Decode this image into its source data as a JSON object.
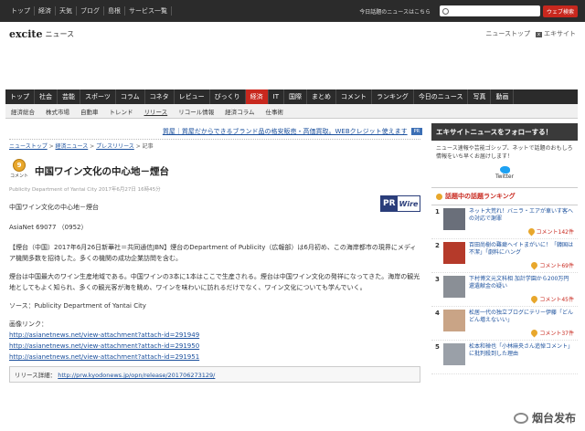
{
  "topbar": {
    "links": [
      "トップ",
      "経済",
      "天気",
      "ブログ",
      "島根",
      "サービス一覧"
    ],
    "today_news": "今日話題のニュースはこちら",
    "search_button": "ウェブ検索"
  },
  "header": {
    "logo": "excite",
    "logo_sub": "ニュース",
    "news_top": "ニューストップ",
    "excite_site": "エキサイト"
  },
  "nav_primary": [
    "トップ",
    "社会",
    "芸能",
    "スポーツ",
    "コラム",
    "コネタ",
    "レビュー",
    "びっくり",
    "経済",
    "IT",
    "国際",
    "まとめ",
    "コメント",
    "ランキング",
    "今日のニュース",
    "写真",
    "動画"
  ],
  "nav_secondary": [
    "経済総合",
    "株式市場",
    "自動車",
    "トレンド",
    "リリース",
    "リコール情報",
    "経済コラム",
    "仕事術"
  ],
  "banner": {
    "text": "質屋｜質屋だからできるブランド品の格安販売・高価買取。WEBクレジット使えます",
    "tag": "PR"
  },
  "breadcrumb": {
    "items": [
      "ニューストップ",
      "経済ニュース",
      "プレスリリース"
    ],
    "current": "記事"
  },
  "article": {
    "comment_label": "コメント",
    "title": "中国ワイン文化の中心地－煙台",
    "byline": "Publicity Department of Yantai City 2017年6月27日 16時45分",
    "subtitle": "中国ワイン文化の中心地－煙台",
    "release_id": "AsiaNet 69077 （0952）",
    "para1": "【煙台（中国）2017年6月26日新華社＝共同通信JBN】煙台のDepartment of Publicity（広報部）は6月初め、この海岸都市の現界にメディア機関多数を招待した。多くの機関の成功企業訪問を含む。",
    "para2": "煙台は中国最大のワイン生産地域である。中国ワインの3本に1本はここで生産される。煙台は中国ワイン文化の発祥になってきた。海岸の観光地としてもよく知られ、多くの観光客が海を眺め、ワインを味わいに訪れるだけでなく、ワイン文化についても学んでいく。",
    "source": "ソース：Publicity Department of Yantai City",
    "image_links_label": "画像リンク：",
    "image_links": [
      "http://asianetnews.net/view-attachment?attach-id=291949",
      "http://asianetnews.net/view-attachment?attach-id=291950",
      "http://asianetnews.net/view-attachment?attach-id=291951"
    ],
    "release_detail_label": "リリース詳細：",
    "release_detail_url": "http://prw.kyodonews.jp/opn/release/201706273129/",
    "pr_logo_pr": "PR",
    "pr_logo_wire": "Wire"
  },
  "sidebar": {
    "follow_title": "エキサイトニュースをフォローする！",
    "follow_text": "ニュース速報や芸能ゴシップ、ネットで話題のおもしろ情報をいち早くお届けします！",
    "twitter_label": "Twitter",
    "ranking_title": "話題中の話題ランキング",
    "ranking": [
      {
        "rank": "1",
        "title": "ネット大荒れ！バニラ・エアが車いす客への対応で謝罪",
        "comments": "コメント142件",
        "thumb_color": "#6a6f7a"
      },
      {
        "rank": "2",
        "title": "百田尚樹の難癖ヘイトまがいに！「韓国は不潔」「劇料にハング",
        "comments": "コメント69件",
        "thumb_color": "#b53a2a"
      },
      {
        "rank": "3",
        "title": "下村博文元文科相 加計学園から200万円還遺献金の疑い",
        "comments": "コメント45件",
        "thumb_color": "#8a8f96"
      },
      {
        "rank": "4",
        "title": "松居一代の独立ブログにテリー伊藤「どんどん増えないい」",
        "comments": "コメント37件",
        "thumb_color": "#c9a486"
      },
      {
        "rank": "5",
        "title": "松本和禅也「小林麻央さん追悼コメント」に批判殺到した理由",
        "comments": "",
        "thumb_color": "#9aa0a8"
      }
    ]
  },
  "watermark": "烟台发布"
}
